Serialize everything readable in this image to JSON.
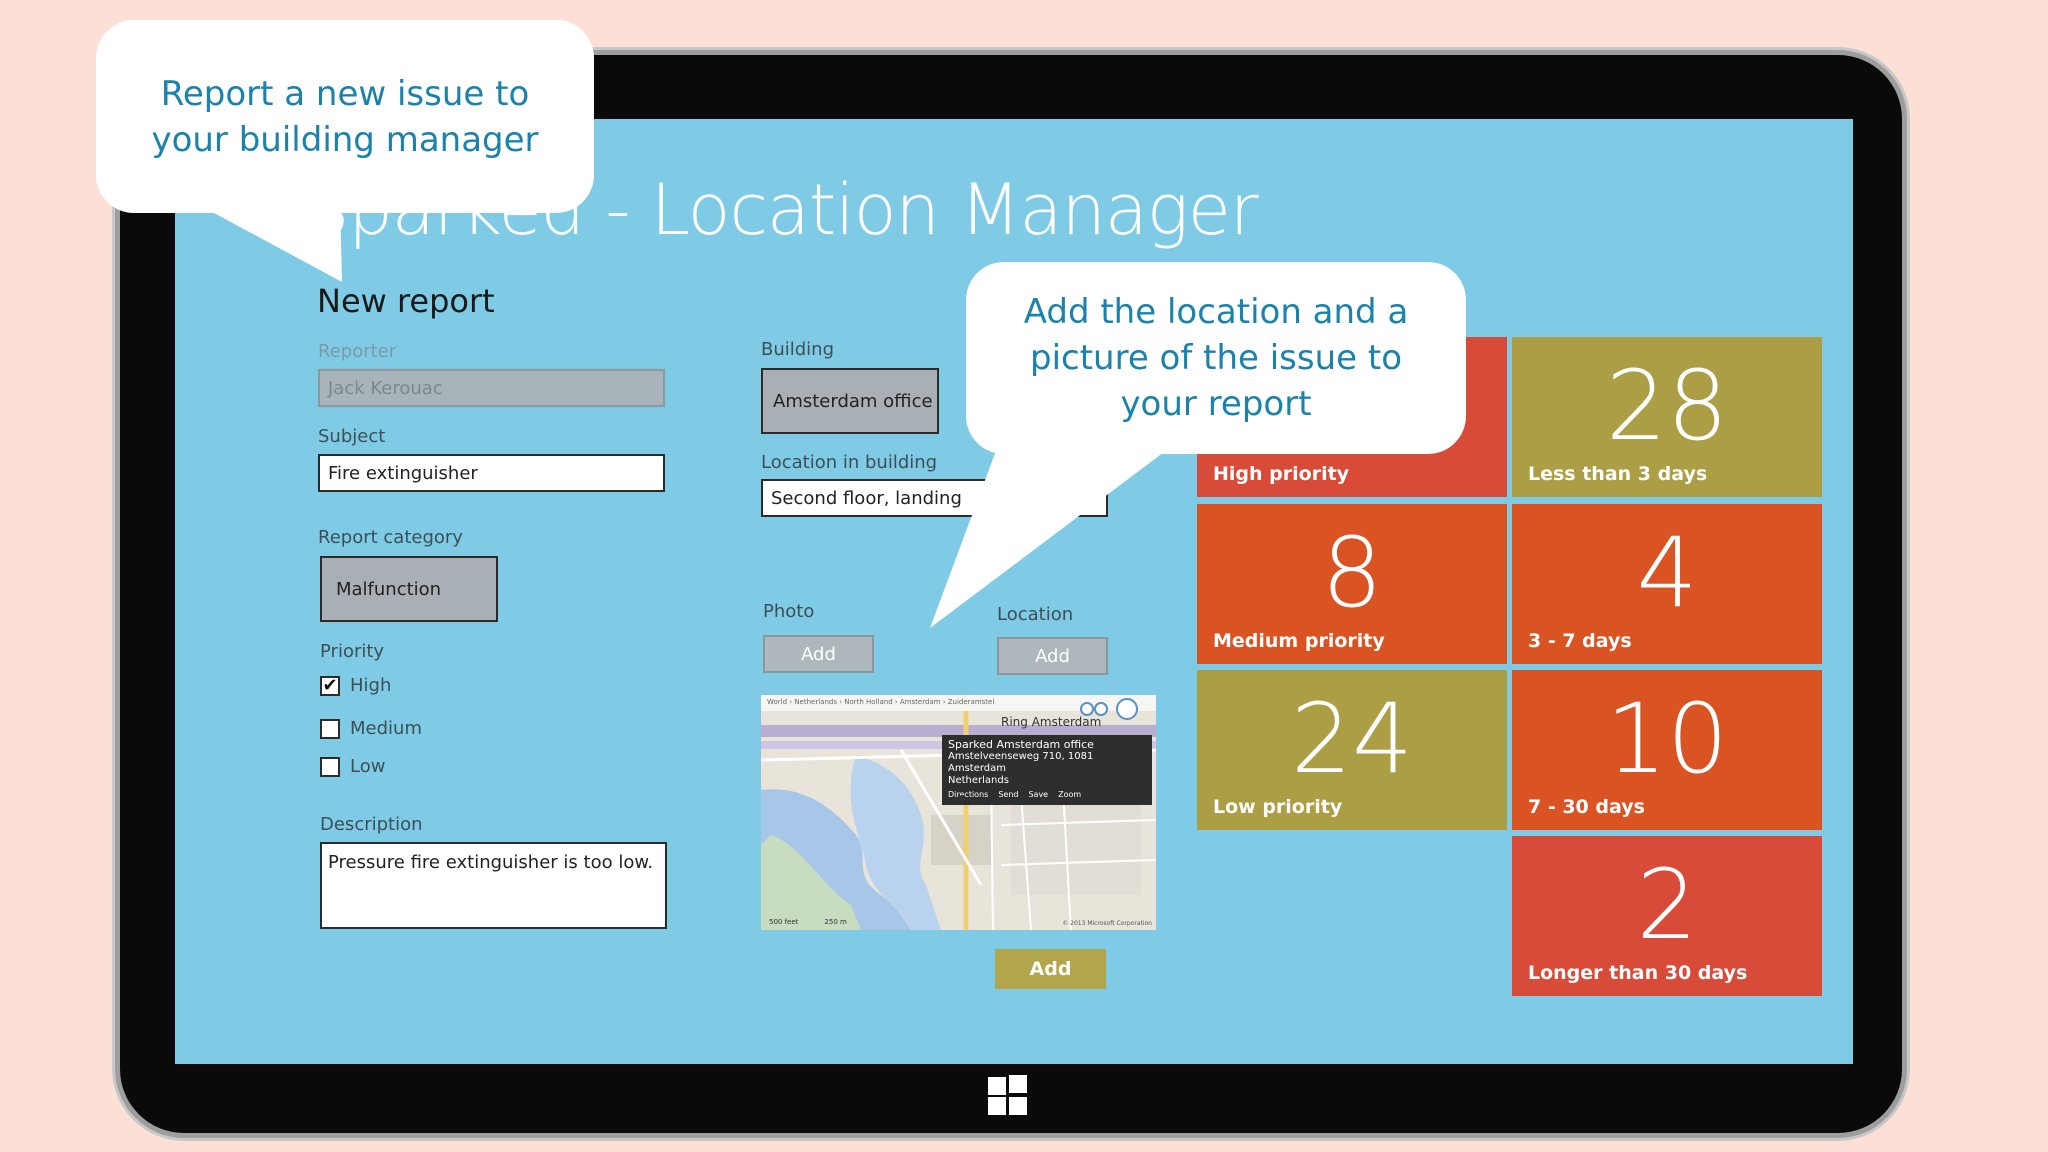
{
  "app": {
    "title": "Sparked - Location Manager"
  },
  "form": {
    "heading": "New report",
    "reporter": {
      "label": "Reporter",
      "value": "Jack Kerouac"
    },
    "subject": {
      "label": "Subject",
      "value": "Fire extinguisher"
    },
    "category": {
      "label": "Report category",
      "value": "Malfunction"
    },
    "priority": {
      "label": "Priority",
      "options": [
        {
          "label": "High",
          "checked": true
        },
        {
          "label": "Medium",
          "checked": false
        },
        {
          "label": "Low",
          "checked": false
        }
      ]
    },
    "description": {
      "label": "Description",
      "value": "Pressure fire extinguisher is too low."
    },
    "building": {
      "label": "Building",
      "value": "Amsterdam office"
    },
    "location_in_building": {
      "label": "Location in building",
      "value": "Second floor, landing"
    },
    "photo": {
      "label": "Photo",
      "button": "Add"
    },
    "location": {
      "label": "Location",
      "button": "Add"
    },
    "submit": "Add"
  },
  "map": {
    "road_label": "Ring Amsterdam",
    "breadcrumb": "World › Netherlands › North Holland › Amsterdam › Zuideramstel",
    "tooltip": {
      "title": "Sparked Amsterdam office",
      "address": "Amstelveenseweg 710, 1081 Amsterdam",
      "country": "Netherlands",
      "links": [
        "Directions",
        "Send",
        "Save",
        "Zoom"
      ]
    },
    "scale_ft": "500 feet",
    "scale_m": "250 m",
    "copyright": "© 2013 Microsoft Corporation"
  },
  "tiles": [
    {
      "id": "high",
      "number": "",
      "caption": "High priority",
      "color": "#d84b39"
    },
    {
      "id": "lt3",
      "number": "28",
      "caption": "Less than 3 days",
      "color": "#ab9e45"
    },
    {
      "id": "medium",
      "number": "8",
      "caption": "Medium priority",
      "color": "#da5323"
    },
    {
      "id": "3to7",
      "number": "4",
      "caption": "3 - 7 days",
      "color": "#da5323"
    },
    {
      "id": "low",
      "number": "24",
      "caption": "Low priority",
      "color": "#ab9e45"
    },
    {
      "id": "7to30",
      "number": "10",
      "caption": "7 - 30 days",
      "color": "#da5323"
    },
    {
      "id": "gt30",
      "number": "2",
      "caption": "Longer than 30 days",
      "color": "#d84b39"
    }
  ],
  "callouts": {
    "first": "Report a new issue to your building manager",
    "second": "Add the location and a picture of the issue to your report"
  }
}
